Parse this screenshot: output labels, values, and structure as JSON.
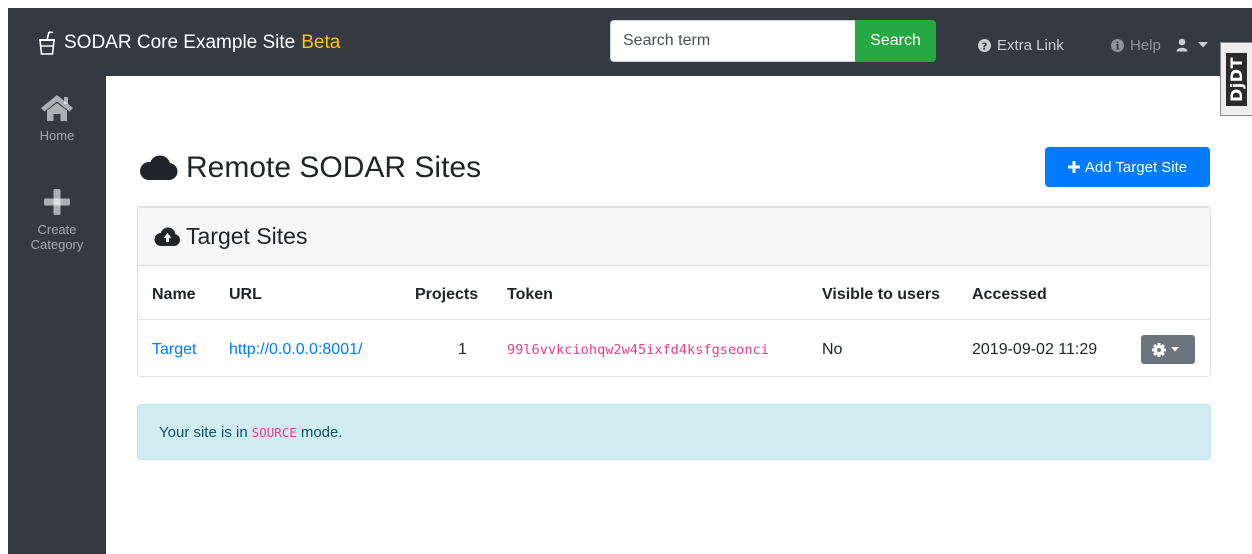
{
  "navbar": {
    "site_name": "SODAR Core Example Site",
    "badge": "Beta",
    "search": {
      "placeholder": "Search term",
      "button_label": "Search"
    },
    "extra_link_label": "Extra Link",
    "help_label": "Help",
    "icons": {
      "brand": "cup-icon",
      "extra": "question-circle-icon",
      "help": "info-circle-icon",
      "user": "user-icon"
    }
  },
  "debug_toolbar": {
    "label": "DjDT"
  },
  "sidebar": {
    "items": [
      {
        "label": "Home",
        "icon": "home-icon"
      },
      {
        "label": "Create Category",
        "icon": "plus-icon"
      }
    ]
  },
  "main": {
    "title": "Remote SODAR Sites",
    "title_icon": "cloud-icon",
    "add_button_label": "Add Target Site",
    "card": {
      "title": "Target Sites",
      "title_icon": "cloud-upload-icon",
      "columns": [
        "Name",
        "URL",
        "Projects",
        "Token",
        "Visible to users",
        "Accessed"
      ],
      "rows": [
        {
          "name": "Target",
          "url": "http://0.0.0.0:8001/",
          "projects": "1",
          "token": "99l6vvkciohqw2w45ixfd4ksfgseonci",
          "visible": "No",
          "accessed": "2019-09-02 11:29"
        }
      ]
    },
    "alert": {
      "prefix": "Your site is in",
      "mode": "SOURCE",
      "suffix": "mode."
    }
  },
  "colors": {
    "navbar_bg": "#343a40",
    "badge": "#ffc107",
    "search_button": "#28a745",
    "primary": "#007bff",
    "code": "#e83e8c",
    "alert_bg": "#d1ecf1",
    "alert_text": "#0c5460"
  }
}
